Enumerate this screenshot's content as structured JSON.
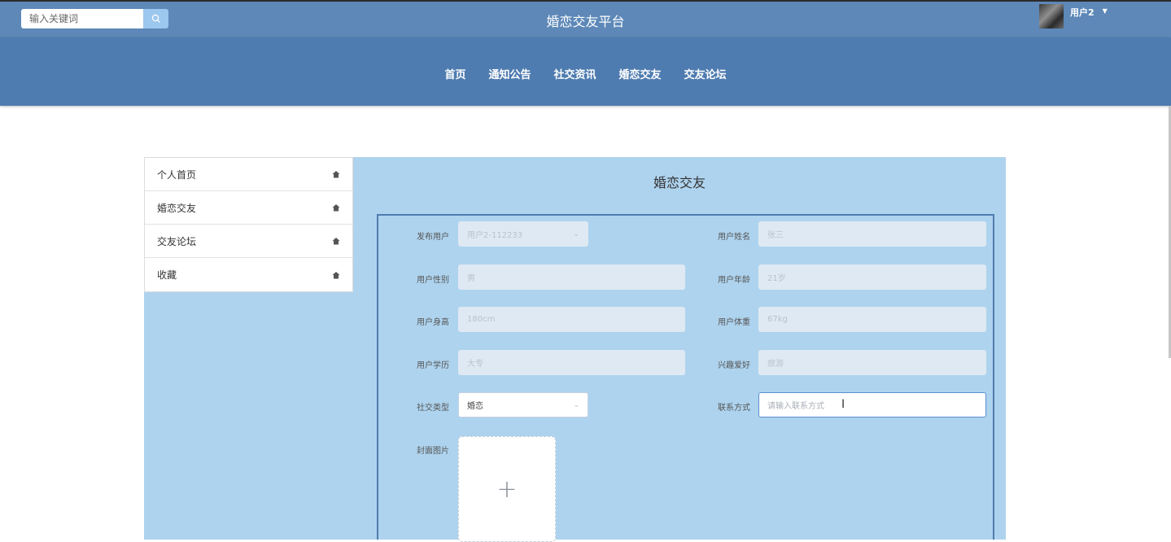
{
  "header": {
    "search_placeholder": "输入关键词",
    "title": "婚恋交友平台",
    "user_name": "用户2",
    "caret": "▼"
  },
  "nav": {
    "items": [
      "首页",
      "通知公告",
      "社交资讯",
      "婚恋交友",
      "交友论坛"
    ]
  },
  "sidebar": {
    "items": [
      "个人首页",
      "婚恋交友",
      "交友论坛",
      "收藏"
    ]
  },
  "panel": {
    "title": "婚恋交友"
  },
  "form": {
    "publisher": {
      "label": "发布用户",
      "value": "用户2-112233"
    },
    "name": {
      "label": "用户姓名",
      "value": "张三"
    },
    "gender": {
      "label": "用户性别",
      "value": "男"
    },
    "age": {
      "label": "用户年龄",
      "value": "21岁"
    },
    "height": {
      "label": "用户身高",
      "value": "180cm"
    },
    "weight": {
      "label": "用户体重",
      "value": "67kg"
    },
    "education": {
      "label": "用户学历",
      "value": "大专"
    },
    "hobby": {
      "label": "兴趣爱好",
      "value": "旅游"
    },
    "social_type": {
      "label": "社交类型",
      "value": "婚恋"
    },
    "contact": {
      "label": "联系方式",
      "placeholder": "请输入联系方式"
    },
    "cover": {
      "label": "封面图片"
    }
  },
  "icons": {
    "search": "search-icon",
    "home": "home-icon",
    "plus": "+",
    "cursor": "I"
  },
  "colors": {
    "topbar": "#5d88b8",
    "navbar": "#4f7cb0",
    "panel": "#aed3ee"
  }
}
